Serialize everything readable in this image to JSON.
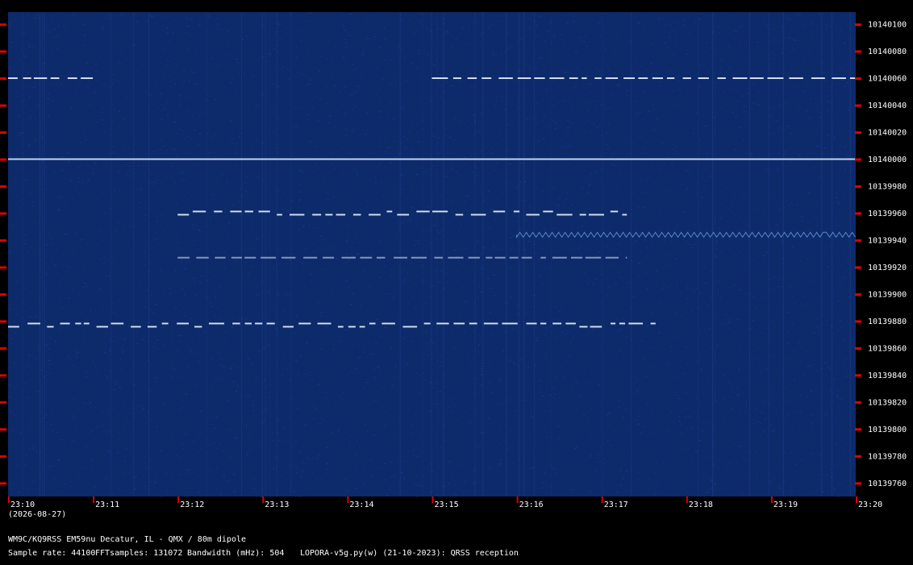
{
  "chart_data": {
    "type": "heatmap",
    "frequency_ticks": [
      "10140100",
      "10140080",
      "10140060",
      "10140040",
      "10140020",
      "10140000",
      "10139980",
      "10139960",
      "10139940",
      "10139920",
      "10139900",
      "10139880",
      "10139860",
      "10139840",
      "10139820",
      "10139800",
      "10139780",
      "10139760"
    ],
    "time_ticks": [
      "23:10",
      "23:11",
      "23:12",
      "23:13",
      "23:14",
      "23:15",
      "23:16",
      "23:17",
      "23:18",
      "23:19",
      "23:20"
    ],
    "date_label": "(2026-08-27)",
    "colors": {
      "background": "#0d2a6b",
      "noise": "#1b3f8f",
      "signal": "#e6f0ff",
      "tick": "#e00000",
      "text": "#ffffff"
    },
    "signals": [
      {
        "freq_hz": 10140000,
        "start": "23:10",
        "end": "23:20",
        "style": "steady"
      },
      {
        "freq_hz": 10140060,
        "start": "23:10",
        "end": "23:11",
        "style": "dashed"
      },
      {
        "freq_hz": 10140060,
        "start": "23:15",
        "end": "23:20",
        "style": "dashed"
      },
      {
        "freq_hz": 10139960,
        "start": "23:12",
        "end": "23:17.3",
        "style": "keyed"
      },
      {
        "freq_hz": 10139944,
        "start": "23:16",
        "end": "23:20",
        "style": "wavy"
      },
      {
        "freq_hz": 10139877,
        "start": "23:10",
        "end": "23:17.7",
        "style": "keyed"
      },
      {
        "freq_hz": 10139927,
        "start": "23:12",
        "end": "23:17.3",
        "style": "faint"
      }
    ]
  },
  "footer": {
    "station": "WM9C/KQ9RSS EM59nu Decatur, IL - QMX / 80m dipole",
    "sample_rate": "Sample rate: 44100",
    "fft_samples": "FFTsamples: 131072",
    "bandwidth": "Bandwidth (mHz): 504",
    "software": "LOPORA-v5g.py(w) (21-10-2023): QRSS reception"
  }
}
